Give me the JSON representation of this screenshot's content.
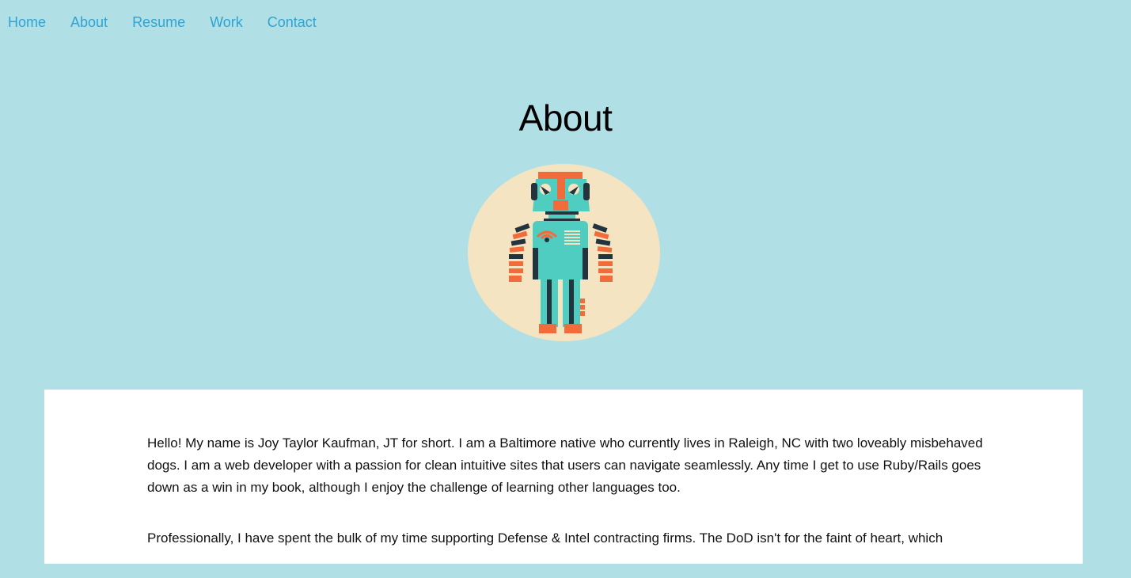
{
  "nav": {
    "items": [
      {
        "label": "Home"
      },
      {
        "label": "About"
      },
      {
        "label": "Resume"
      },
      {
        "label": "Work"
      },
      {
        "label": "Contact"
      }
    ]
  },
  "page": {
    "title": "About"
  },
  "avatar": {
    "icon": "robot-icon",
    "bg_color": "#f4e4c1"
  },
  "content": {
    "paragraphs": [
      "Hello! My name is Joy Taylor Kaufman, JT for short. I am a Baltimore native who currently lives in Raleigh, NC with two loveably misbehaved dogs. I am a web developer with a passion for clean intuitive sites that users can navigate seamlessly. Any time I get to use Ruby/Rails goes down as a win in my book, although I enjoy the challenge of learning other languages too.",
      "Professionally, I have spent the bulk of my time supporting Defense & Intel contracting firms. The DoD isn't for the faint of heart, which"
    ]
  },
  "colors": {
    "background": "#b0dfe5",
    "link": "#2fa4d4",
    "card": "#ffffff"
  }
}
